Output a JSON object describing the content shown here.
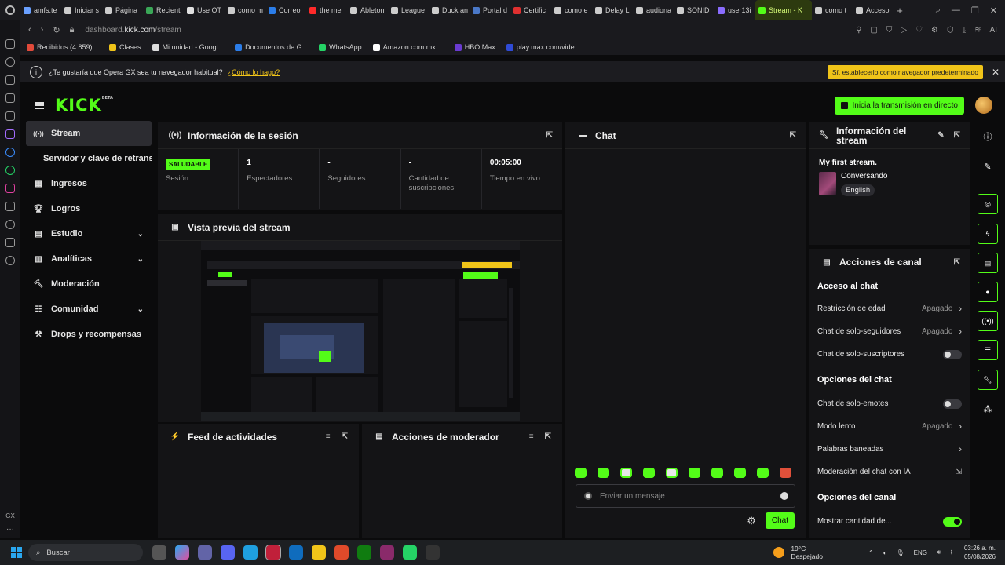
{
  "browser": {
    "tabs": [
      {
        "label": "amfs.te",
        "color": "#6aa0ff"
      },
      {
        "label": "Iniciar s",
        "color": "#cccccc"
      },
      {
        "label": "Página",
        "color": "#cccccc"
      },
      {
        "label": "Recient",
        "color": "#3aa757"
      },
      {
        "label": "Use OT",
        "color": "#e0e0e0"
      },
      {
        "label": "como m",
        "color": "#cccccc"
      },
      {
        "label": "Correo",
        "color": "#2b7de9"
      },
      {
        "label": "the me",
        "color": "#ff2a2a"
      },
      {
        "label": "Ableton",
        "color": "#cccccc"
      },
      {
        "label": "League",
        "color": "#cccccc"
      },
      {
        "label": "Duck an",
        "color": "#cccccc"
      },
      {
        "label": "Portal d",
        "color": "#4a78c8"
      },
      {
        "label": "Certific",
        "color": "#e03030"
      },
      {
        "label": "como e",
        "color": "#cccccc"
      },
      {
        "label": "Delay L",
        "color": "#cccccc"
      },
      {
        "label": "audiona",
        "color": "#cccccc"
      },
      {
        "label": "SONID",
        "color": "#cccccc"
      },
      {
        "label": "user13i",
        "color": "#8a6cff"
      },
      {
        "label": "Stream - K",
        "color": "#53fc18",
        "active": true
      },
      {
        "label": "como t",
        "color": "#cccccc"
      },
      {
        "label": "Acceso",
        "color": "#cccccc"
      }
    ],
    "url_prefix": "dashboard.",
    "url_domain": "kick.com",
    "url_path": "/stream",
    "bookmarks": [
      {
        "label": "Recibidos (4.859)...",
        "color": "#e24a3a"
      },
      {
        "label": "Clases",
        "color": "#f0c419"
      },
      {
        "label": "Mi unidad - Googl...",
        "color": "#dddddd"
      },
      {
        "label": "Documentos de G...",
        "color": "#2b7de9"
      },
      {
        "label": "WhatsApp",
        "color": "#25d366"
      },
      {
        "label": "Amazon.com.mx:...",
        "color": "#ffffff"
      },
      {
        "label": "HBO Max",
        "color": "#6a3bd1"
      },
      {
        "label": "play.max.com/vide...",
        "color": "#2f4bd6"
      }
    ],
    "banner": {
      "question": "¿Te gustaría que Opera GX sea tu navegador habitual?",
      "link": "¿Cómo lo hago?",
      "button": "Sí, establecerlo como navegador predeterminado"
    },
    "gx_label": "GX"
  },
  "kick": {
    "logo": "KICK",
    "logo_sup": "BETA",
    "live_button": "Inicia la transmisión en directo",
    "accent": "#53fc18"
  },
  "nav": [
    {
      "label": "Stream",
      "icon": "stream-icon",
      "active": true
    },
    {
      "label": "Servidor y clave de retransmisión",
      "sub": true
    },
    {
      "label": "Ingresos",
      "icon": "income-icon"
    },
    {
      "label": "Logros",
      "icon": "trophy-icon"
    },
    {
      "label": "Estudio",
      "icon": "studio-icon",
      "expand": true
    },
    {
      "label": "Analíticas",
      "icon": "analytics-icon",
      "expand": true
    },
    {
      "label": "Moderación",
      "icon": "moderation-icon"
    },
    {
      "label": "Comunidad",
      "icon": "community-icon",
      "expand": true
    },
    {
      "label": "Drops y recompensas",
      "icon": "drops-icon"
    }
  ],
  "session": {
    "title": "Información de la sesión",
    "status": "SALUDABLE",
    "status_label": "Sesión",
    "viewers": "1",
    "viewers_label": "Espectadores",
    "followers": "-",
    "followers_label": "Seguidores",
    "subs": "-",
    "subs_label": "Cantidad de suscripciones",
    "uptime": "00:05:00",
    "uptime_label": "Tiempo en vivo"
  },
  "preview": {
    "title": "Vista previa del stream"
  },
  "feed": {
    "title": "Feed de actividades"
  },
  "mod_actions": {
    "title": "Acciones de moderador"
  },
  "chat": {
    "title": "Chat",
    "placeholder": "Enviar un mensaje",
    "send": "Chat"
  },
  "stream_info": {
    "title": "Información del stream",
    "stream_title": "My first stream.",
    "category": "Conversando",
    "tag": "English"
  },
  "channel_actions": {
    "title": "Acciones de canal",
    "chat_access": "Acceso al chat",
    "age_restriction": "Restricción de edad",
    "age_restriction_value": "Apagado",
    "followers_only": "Chat de solo-seguidores",
    "followers_only_value": "Apagado",
    "subs_only": "Chat de solo-suscriptores",
    "chat_options": "Opciones del chat",
    "emotes_only": "Chat de solo-emotes",
    "slow_mode": "Modo lento",
    "slow_mode_value": "Apagado",
    "banned_words": "Palabras baneadas",
    "ai_moderation": "Moderación del chat con IA",
    "channel_options": "Opciones del canal",
    "show_count": "Mostrar cantidad de..."
  },
  "taskbar": {
    "search": "Buscar",
    "temperature": "19°C",
    "weather": "Despejado",
    "lang": "ENG",
    "time": "03:26 a. m.",
    "date": "05/08/2026"
  }
}
